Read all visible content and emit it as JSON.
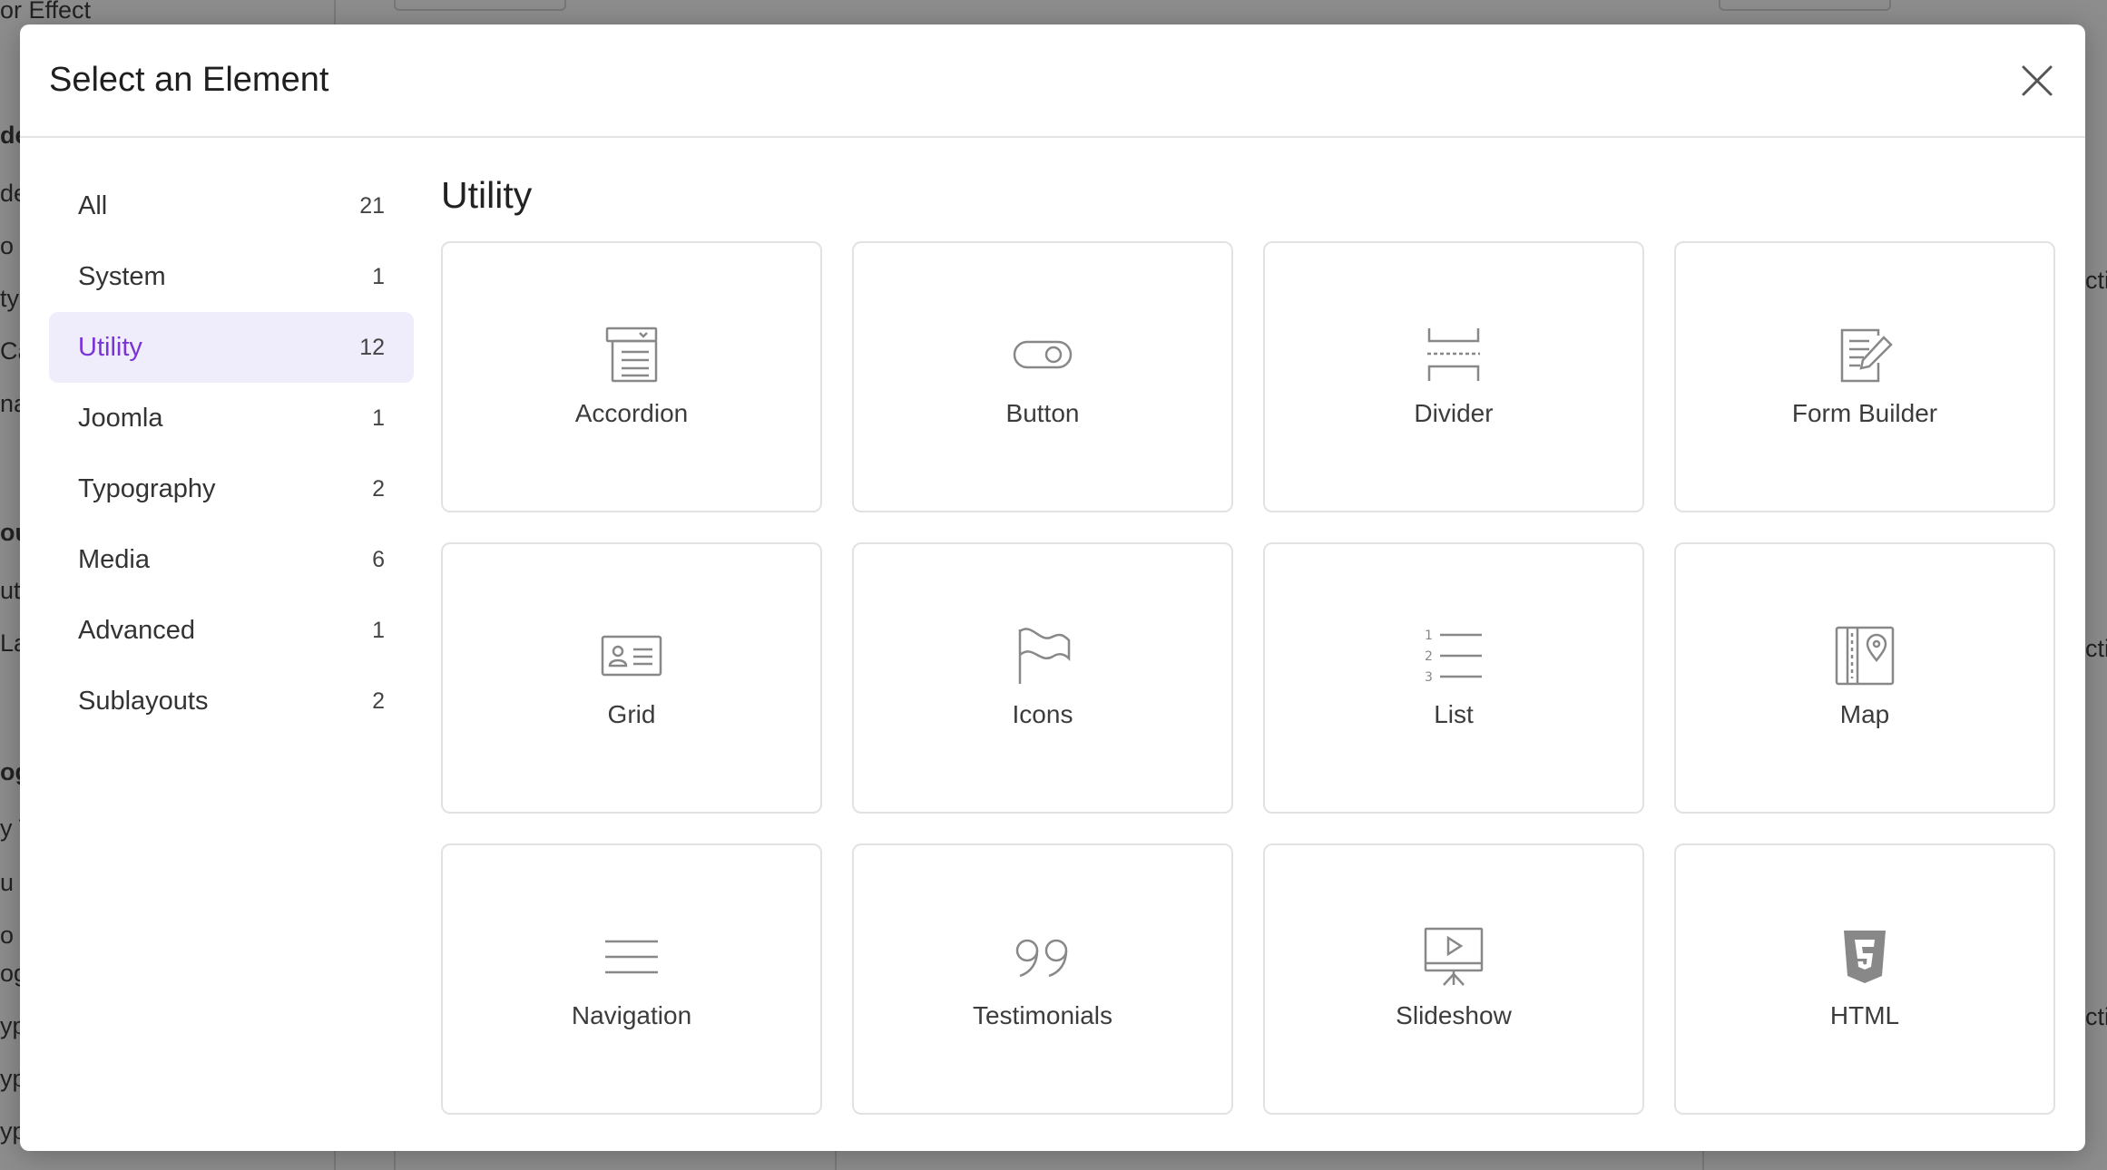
{
  "background": {
    "texts": [
      {
        "text": "or Effect",
        "bold": false
      },
      {
        "text": "de",
        "bold": true
      },
      {
        "text": "de",
        "bold": false
      },
      {
        "text": "o C",
        "bold": false
      },
      {
        "text": "ty",
        "bold": false
      },
      {
        "text": "Ca",
        "bold": false
      },
      {
        "text": "na",
        "bold": false
      },
      {
        "text": "ou",
        "bold": true
      },
      {
        "text": "ut",
        "bold": false
      },
      {
        "text": "La",
        "bold": false
      },
      {
        "text": "og",
        "bold": true
      },
      {
        "text": "y T",
        "bold": false
      },
      {
        "text": "u T",
        "bold": false
      },
      {
        "text": "o D",
        "bold": false
      },
      {
        "text": "og",
        "bold": false
      },
      {
        "text": "yp",
        "bold": false
      },
      {
        "text": "yp",
        "bold": false
      },
      {
        "text": "yp",
        "bold": false
      }
    ],
    "right_texts": [
      "cti",
      "cti",
      "cti"
    ]
  },
  "modal": {
    "title": "Select an Element",
    "close_icon": "close-icon"
  },
  "sidebar": {
    "items": [
      {
        "label": "All",
        "count": "21",
        "active": false
      },
      {
        "label": "System",
        "count": "1",
        "active": false
      },
      {
        "label": "Utility",
        "count": "12",
        "active": true
      },
      {
        "label": "Joomla",
        "count": "1",
        "active": false
      },
      {
        "label": "Typography",
        "count": "2",
        "active": false
      },
      {
        "label": "Media",
        "count": "6",
        "active": false
      },
      {
        "label": "Advanced",
        "count": "1",
        "active": false
      },
      {
        "label": "Sublayouts",
        "count": "2",
        "active": false
      }
    ]
  },
  "main": {
    "section_title": "Utility",
    "elements": [
      {
        "label": "Accordion",
        "icon": "accordion-icon"
      },
      {
        "label": "Button",
        "icon": "button-icon"
      },
      {
        "label": "Divider",
        "icon": "divider-icon"
      },
      {
        "label": "Form Builder",
        "icon": "form-builder-icon"
      },
      {
        "label": "Grid",
        "icon": "grid-icon"
      },
      {
        "label": "Icons",
        "icon": "flag-icon"
      },
      {
        "label": "List",
        "icon": "list-icon"
      },
      {
        "label": "Map",
        "icon": "map-icon"
      },
      {
        "label": "Navigation",
        "icon": "navigation-icon"
      },
      {
        "label": "Testimonials",
        "icon": "quote-icon"
      },
      {
        "label": "Slideshow",
        "icon": "slideshow-icon"
      },
      {
        "label": "HTML",
        "icon": "html5-icon"
      }
    ]
  },
  "colors": {
    "accent": "#7a34d8",
    "active_bg": "#efecfb",
    "overlay": "#8d8d8d"
  }
}
